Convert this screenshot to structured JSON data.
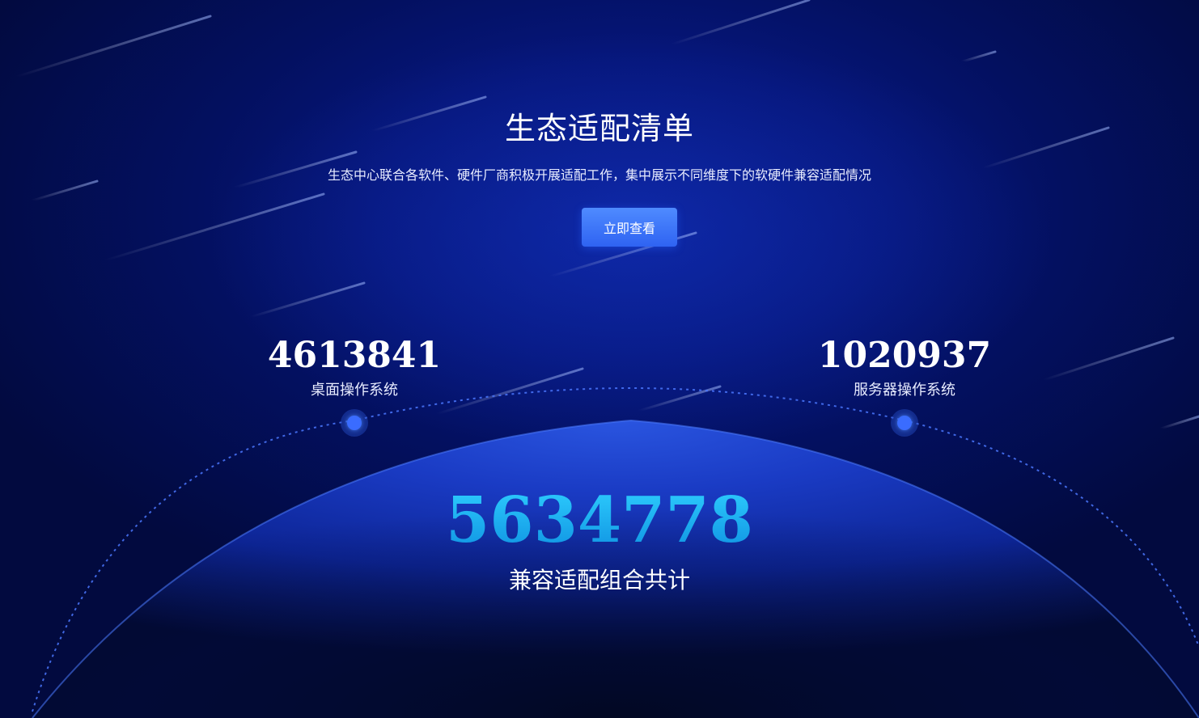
{
  "hero": {
    "title": "生态适配清单",
    "subtitle": "生态中心联合各软件、硬件厂商积极开展适配工作，集中展示不同维度下的软硬件兼容适配情况",
    "cta_label": "立即查看"
  },
  "stats": {
    "desktop": {
      "value": "4613841",
      "label": "桌面操作系统"
    },
    "server": {
      "value": "1020937",
      "label": "服务器操作系统"
    }
  },
  "total": {
    "value": "5634778",
    "label": "兼容适配组合共计"
  },
  "colors": {
    "background": "#020a3a",
    "accent": "#3a6cff",
    "total_value": "#12b6ff",
    "button": "#3b72f7"
  }
}
